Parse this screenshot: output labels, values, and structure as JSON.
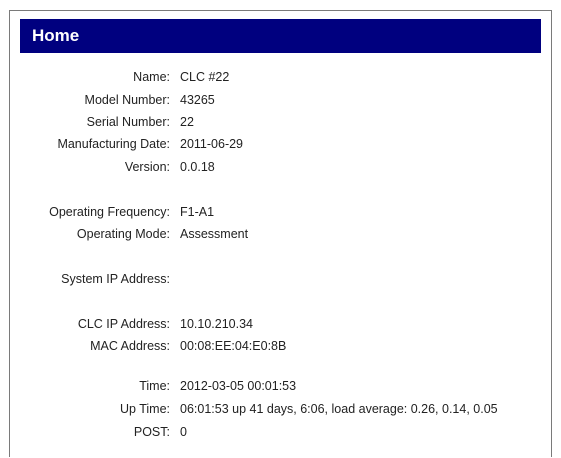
{
  "page": {
    "title": "Home"
  },
  "fields": {
    "name": {
      "label": "Name:",
      "value": "CLC #22"
    },
    "model_number": {
      "label": "Model Number:",
      "value": "43265"
    },
    "serial_number": {
      "label": "Serial Number:",
      "value": "22"
    },
    "manufacturing_date": {
      "label": "Manufacturing Date:",
      "value": "2011-06-29"
    },
    "version": {
      "label": "Version:",
      "value": "0.0.18"
    },
    "operating_frequency": {
      "label": "Operating Frequency:",
      "value": "F1-A1"
    },
    "operating_mode": {
      "label": "Operating Mode:",
      "value": "Assessment"
    },
    "system_ip": {
      "label": "System IP Address:",
      "value": ""
    },
    "clc_ip": {
      "label": "CLC IP Address:",
      "value": "10.10.210.34"
    },
    "mac_address": {
      "label": "MAC Address:",
      "value": "00:08:EE:04:E0:8B"
    },
    "time": {
      "label": "Time:",
      "value": "2012-03-05 00:01:53"
    },
    "up_time": {
      "label": "Up Time:",
      "value": "06:01:53 up 41 days, 6:06, load average: 0.26, 0.14, 0.05"
    },
    "post": {
      "label": "POST:",
      "value": "0"
    }
  }
}
